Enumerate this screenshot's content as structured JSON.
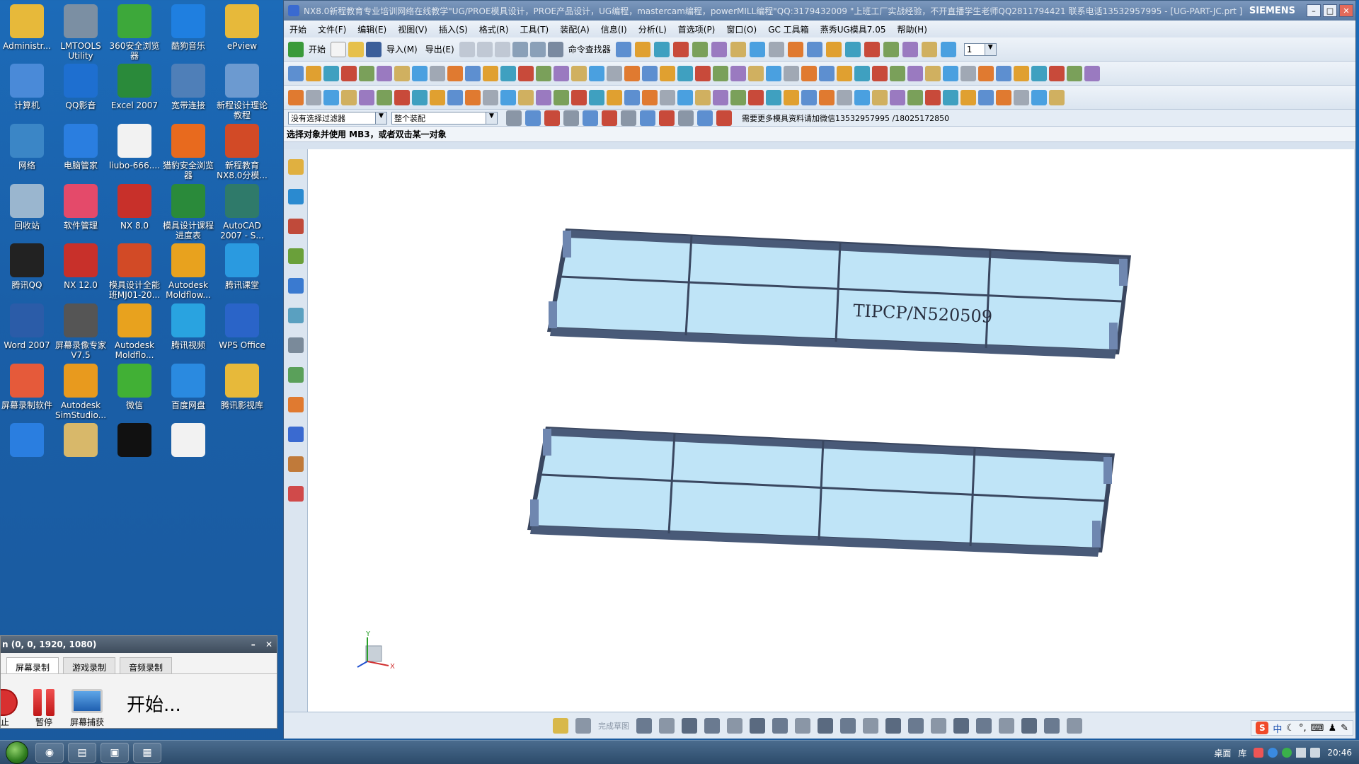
{
  "desktop": {
    "icons": [
      {
        "label": "Administr...",
        "icon": "folder-icon",
        "color": "#e7b93a"
      },
      {
        "label": "LMTOOLS Utility",
        "icon": "lmtools-icon",
        "color": "#7b8fa3"
      },
      {
        "label": "360安全浏览器",
        "icon": "browser-360-icon",
        "color": "#3da83a"
      },
      {
        "label": "酷狗音乐",
        "icon": "kugou-icon",
        "color": "#1f7fe0"
      },
      {
        "label": "ePview",
        "icon": "folder-icon",
        "color": "#e7b93a"
      },
      {
        "label": "计算机",
        "icon": "computer-icon",
        "color": "#4a8ad8"
      },
      {
        "label": "QQ影音",
        "icon": "qq-player-icon",
        "color": "#1e6fd0"
      },
      {
        "label": "Excel 2007",
        "icon": "excel-icon",
        "color": "#2a8a3a"
      },
      {
        "label": "宽带连接",
        "icon": "network-connection-icon",
        "color": "#4f7fb8"
      },
      {
        "label": "新程设计理论教程",
        "icon": "media-icon",
        "color": "#6c9ad0"
      },
      {
        "label": "网络",
        "icon": "network-icon",
        "color": "#3b86c6"
      },
      {
        "label": "电脑管家",
        "icon": "pc-manager-icon",
        "color": "#2a7ee0"
      },
      {
        "label": "liubo-666....",
        "icon": "document-icon",
        "color": "#f2f2f2"
      },
      {
        "label": "猎豹安全浏览器",
        "icon": "cheetah-browser-icon",
        "color": "#e86a1e"
      },
      {
        "label": "新程教育NX8.0分模...",
        "icon": "ppt-icon",
        "color": "#d24a26"
      },
      {
        "label": "回收站",
        "icon": "recycle-bin-icon",
        "color": "#9ab6cf"
      },
      {
        "label": "软件管理",
        "icon": "software-manager-icon",
        "color": "#e44a6a"
      },
      {
        "label": "NX 8.0",
        "icon": "nx-icon",
        "color": "#c8302a"
      },
      {
        "label": "模具设计课程进度表",
        "icon": "excel-doc-icon",
        "color": "#2a8a3a"
      },
      {
        "label": "AutoCAD 2007 - S...",
        "icon": "autocad-icon",
        "color": "#2f7a6a"
      },
      {
        "label": "腾讯QQ",
        "icon": "qq-icon",
        "color": "#222222"
      },
      {
        "label": "NX 12.0",
        "icon": "nx-icon",
        "color": "#c8302a"
      },
      {
        "label": "模具设计全能班MJ01-20...",
        "icon": "ppt-icon",
        "color": "#d24a26"
      },
      {
        "label": "Autodesk Moldflow...",
        "icon": "moldflow-icon",
        "color": "#e8a21e"
      },
      {
        "label": "腾讯课堂",
        "icon": "tencent-classroom-icon",
        "color": "#2a9ae0"
      },
      {
        "label": "Word 2007",
        "icon": "word-icon",
        "color": "#2b5ca8"
      },
      {
        "label": "屏幕录像专家 V7.5",
        "icon": "screen-recorder-icon",
        "color": "#555555"
      },
      {
        "label": "Autodesk Moldflo...",
        "icon": "moldflow-icon",
        "color": "#e8a21e"
      },
      {
        "label": "腾讯视频",
        "icon": "tencent-video-icon",
        "color": "#29a3e0"
      },
      {
        "label": "WPS Office",
        "icon": "wps-icon",
        "color": "#2a64c8"
      },
      {
        "label": "屏幕录制软件",
        "icon": "recording-software-icon",
        "color": "#e55a3a"
      },
      {
        "label": "Autodesk SimStudio...",
        "icon": "simstudio-icon",
        "color": "#e89a1e"
      },
      {
        "label": "微信",
        "icon": "wechat-icon",
        "color": "#41b035"
      },
      {
        "label": "百度网盘",
        "icon": "baidu-netdisk-icon",
        "color": "#2a8ae0"
      },
      {
        "label": "腾讯影视库",
        "icon": "folder-icon",
        "color": "#e7b93a"
      },
      {
        "label": "",
        "icon": "app-icon",
        "color": "#2a7ee0"
      },
      {
        "label": "",
        "icon": "folder-icon",
        "color": "#d8b86a"
      },
      {
        "label": "",
        "icon": "app-icon",
        "color": "#111111"
      },
      {
        "label": "",
        "icon": "document-icon",
        "color": "#f2f2f2"
      }
    ]
  },
  "recorder": {
    "title": "n (0, 0, 1920, 1080)",
    "tabs": [
      "屏幕录制",
      "游戏录制",
      "音频录制"
    ],
    "stop_label": "止",
    "pause_label": "暂停",
    "capture_label": "屏幕捕获",
    "start_label": "开始..."
  },
  "nx": {
    "title": "NX8.0新程教育专业培训网络在线教学\"UG/PROE模具设计，PROE产品设计，UG编程，mastercam编程，powerMILL编程\"QQ:3179432009 \"上班工厂实战经验，不开直播学生老师QQ2811794421 联系电话13532957995 - [UG-PART-JC.prt ]",
    "brand": "SIEMENS",
    "menu": [
      "开始",
      "文件(F)",
      "编辑(E)",
      "视图(V)",
      "插入(S)",
      "格式(R)",
      "工具(T)",
      "装配(A)",
      "信息(I)",
      "分析(L)",
      "首选项(P)",
      "窗口(O)",
      "GC 工具箱",
      "燕秀UG模具7.05",
      "帮助(H)"
    ],
    "toolbar1": {
      "start": "开始",
      "import": "导入(M)",
      "export": "导出(E)",
      "command_finder": "命令查找器",
      "layer_value": "1"
    },
    "filterbar": {
      "type_filter": "没有选择过滤器",
      "scope": "整个装配",
      "promo": "需要更多模具资料请加微信13532957995 /18025172850"
    },
    "status_message": "选择对象并使用 MB3，或者双击某一对象",
    "part_label": "TIPCP/N520509",
    "sketch_label": "完成草图"
  },
  "taskbar": {
    "tray_text": "桌面",
    "tray_text2": "库",
    "ime": "中",
    "time": "20:46"
  },
  "colors": {
    "part_face": "#bfe4f7",
    "part_edge": "#3a4760",
    "part_dark": "#495a78",
    "desktop_bg": "#1c6bb8"
  }
}
